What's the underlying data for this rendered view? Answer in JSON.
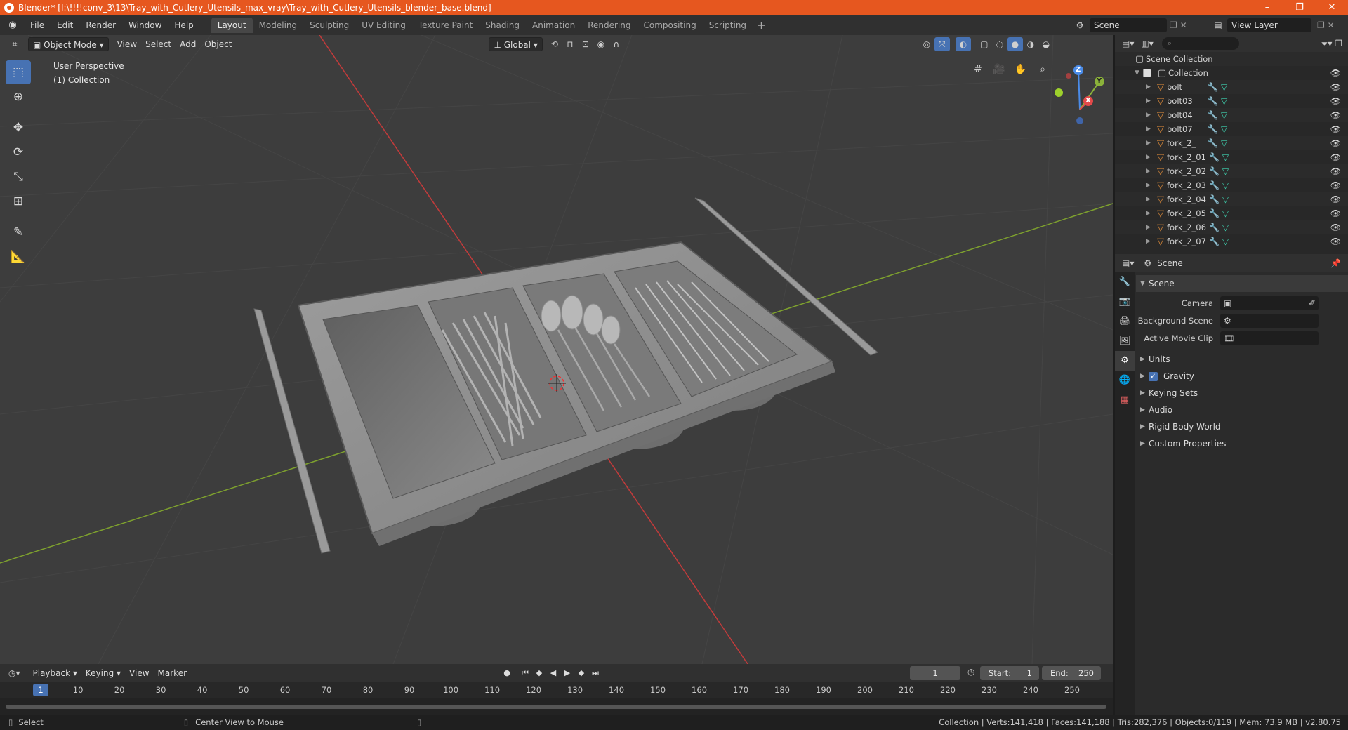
{
  "window": {
    "title": "Blender* [I:\\!!!!conv_3\\13\\Tray_with_Cutlery_Utensils_max_vray\\Tray_with_Cutlery_Utensils_blender_base.blend]",
    "controls": [
      "–",
      "❐",
      "✕"
    ]
  },
  "menu": [
    "File",
    "Edit",
    "Render",
    "Window",
    "Help"
  ],
  "workspaces": [
    "Layout",
    "Modeling",
    "Sculpting",
    "UV Editing",
    "Texture Paint",
    "Shading",
    "Animation",
    "Rendering",
    "Compositing",
    "Scripting"
  ],
  "active_workspace": "Layout",
  "scene_name": "Scene",
  "view_layer": "View Layer",
  "viewport": {
    "mode": "Object Mode",
    "menus": [
      "View",
      "Select",
      "Add",
      "Object"
    ],
    "orientation": "Global",
    "perspective_label": "User Perspective",
    "collection_label": "(1) Collection",
    "gizmo_axes": {
      "x": "X",
      "y": "Y",
      "z": "Z"
    }
  },
  "toolbar": [
    "select-box",
    "cursor",
    "move",
    "rotate",
    "scale",
    "transform",
    "annotate",
    "measure"
  ],
  "outliner": {
    "root": "Scene Collection",
    "collection": "Collection",
    "objects": [
      "bolt",
      "bolt03",
      "bolt04",
      "bolt07",
      "fork_2_",
      "fork_2_01",
      "fork_2_02",
      "fork_2_03",
      "fork_2_04",
      "fork_2_05",
      "fork_2_06",
      "fork_2_07"
    ]
  },
  "properties": {
    "header": "Scene",
    "panel_title": "Scene",
    "fields": {
      "camera": "Camera",
      "background_scene": "Background Scene",
      "active_movie_clip": "Active Movie Clip"
    },
    "subpanels": [
      "Units",
      "Gravity",
      "Keying Sets",
      "Audio",
      "Rigid Body World",
      "Custom Properties"
    ],
    "gravity_enabled": true
  },
  "timeline": {
    "menus": [
      "Playback",
      "Keying",
      "View",
      "Marker"
    ],
    "current_frame": "1",
    "start_label": "Start:",
    "start": "1",
    "end_label": "End:",
    "end": "250",
    "ticks": [
      "10",
      "20",
      "30",
      "40",
      "50",
      "60",
      "70",
      "80",
      "90",
      "100",
      "110",
      "120",
      "130",
      "140",
      "150",
      "160",
      "170",
      "180",
      "190",
      "200",
      "210",
      "220",
      "230",
      "240",
      "250"
    ]
  },
  "status": {
    "left": "Select",
    "middle": "Center View to Mouse",
    "right": "Collection | Verts:141,418 | Faces:141,188 | Tris:282,376 | Objects:0/119 | Mem: 73.9 MB | v2.80.75"
  },
  "colors": {
    "titlebar": "#e6571f",
    "accent": "#4772b3",
    "viewport_bg": "#3d3d3d",
    "axis_x": "#c33b3b",
    "axis_y": "#7ea12e"
  }
}
